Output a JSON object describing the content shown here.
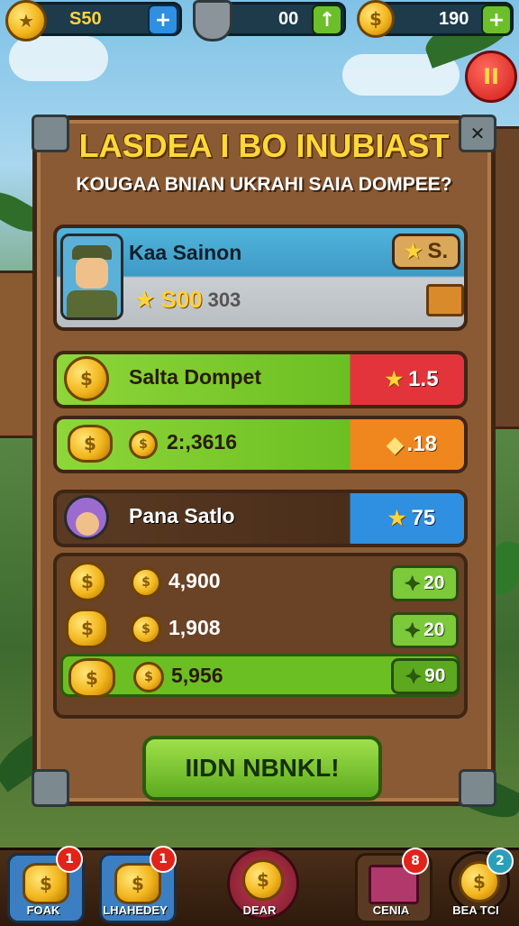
{
  "top_bar": {
    "coins_value": "S50",
    "coins_add": "+",
    "shield_value": "00",
    "shield_add": "↑",
    "gems_value": "190",
    "gems_add": "+"
  },
  "pause_symbol": "II",
  "panel": {
    "title": "LASDEA I BO INUBIAST",
    "subtitle": "KOUGAA BNIAN UKRAHI SAIA DOMPEE?",
    "close_symbol": "✕",
    "profile": {
      "name": "Kaa Sainon",
      "star_value": "S.",
      "coins_main": "S00",
      "coins_sub": "303"
    },
    "wallet": {
      "label": "Salta Dompet",
      "badge_value": "1.5"
    },
    "exchange": {
      "value": "2:,3616",
      "badge_value": ".18"
    },
    "player2": {
      "name": "Pana Satlo",
      "badge_value": "75"
    },
    "list": [
      {
        "value": "4,900",
        "badge": "20"
      },
      {
        "value": "1,908",
        "badge": "20"
      },
      {
        "value": "5,956",
        "badge": "90"
      }
    ],
    "action_button": "IIDN NBNKL!"
  },
  "nav": [
    {
      "label": "FOAK",
      "badge": "1"
    },
    {
      "label": "LHAHEDEY",
      "badge": "1"
    },
    {
      "label": "DEAR",
      "badge": ""
    },
    {
      "label": "CENIA",
      "badge": "8"
    },
    {
      "label": "BEA TCI",
      "badge": "2"
    }
  ],
  "colors": {
    "accent_gold": "#ffd83a",
    "wood": "#8a5a34",
    "green": "#7cc93a",
    "red": "#e2343a",
    "orange": "#f0861e",
    "blue": "#2f8fe0"
  }
}
